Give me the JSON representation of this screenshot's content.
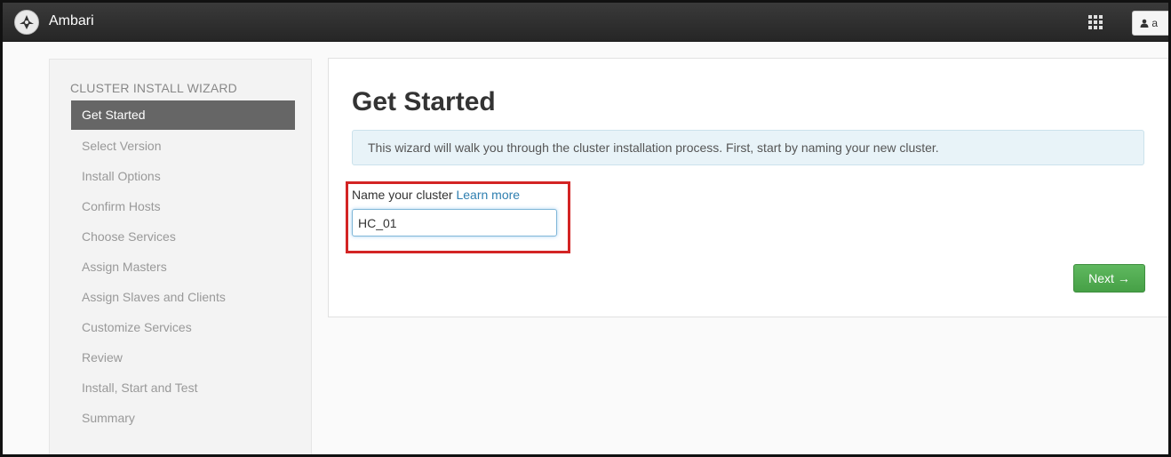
{
  "topbar": {
    "app_title": "Ambari",
    "logo_icon": "ambari-logo-icon",
    "apps_icon": "grid-icon",
    "user_label": "a",
    "user_icon": "user-icon"
  },
  "sidebar": {
    "header": "CLUSTER INSTALL WIZARD",
    "items": [
      {
        "label": "Get Started",
        "active": true
      },
      {
        "label": "Select Version",
        "active": false
      },
      {
        "label": "Install Options",
        "active": false
      },
      {
        "label": "Confirm Hosts",
        "active": false
      },
      {
        "label": "Choose Services",
        "active": false
      },
      {
        "label": "Assign Masters",
        "active": false
      },
      {
        "label": "Assign Slaves and Clients",
        "active": false
      },
      {
        "label": "Customize Services",
        "active": false
      },
      {
        "label": "Review",
        "active": false
      },
      {
        "label": "Install, Start and Test",
        "active": false
      },
      {
        "label": "Summary",
        "active": false
      }
    ]
  },
  "main": {
    "title": "Get Started",
    "info_text": "This wizard will walk you through the cluster installation process. First, start by naming your new cluster.",
    "field_label": "Name your cluster",
    "learn_more": "Learn more",
    "cluster_name_value": "HC_01",
    "next_label": "Next →"
  },
  "colors": {
    "topbar": "#2e2e2e",
    "active_nav": "#666666",
    "next_button": "#4cae4c",
    "highlight": "#d32424",
    "link": "#2f7fb0"
  }
}
